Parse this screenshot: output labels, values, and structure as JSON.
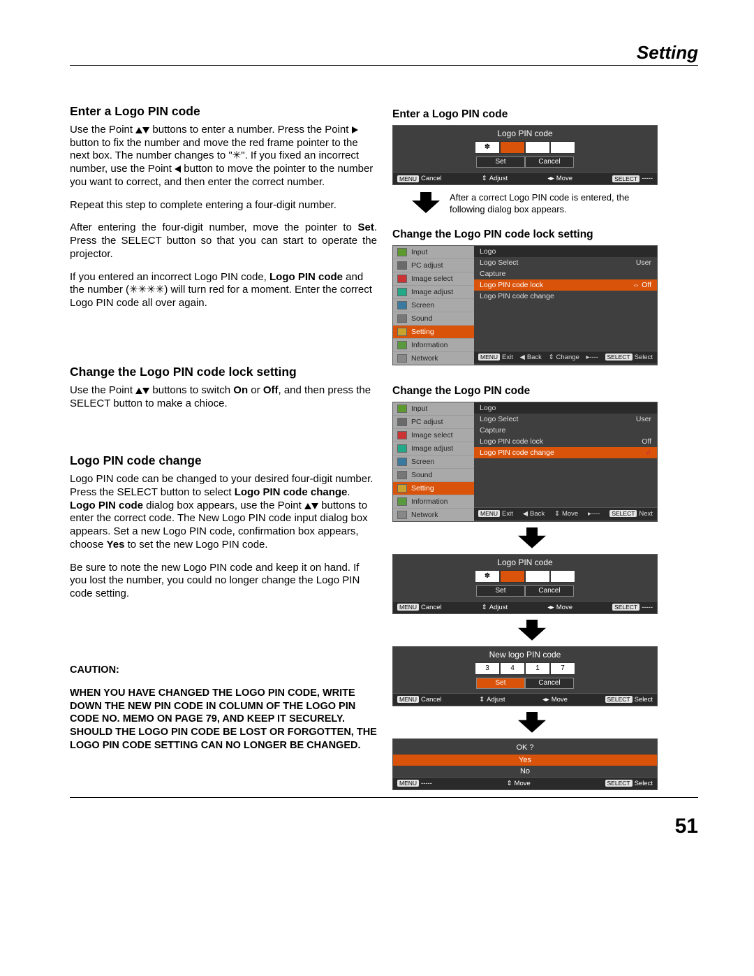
{
  "header": {
    "title": "Setting"
  },
  "left": {
    "h1": "Enter a Logo PIN code",
    "p1a": "Use the Point ",
    "p1b": "buttons to enter a number. Press the Point ",
    "p1c": " button to fix the number and move the red frame pointer to the next box. The number changes to \"✳\". If you fixed an incorrect number, use the Point ",
    "p1d": " button to move the pointer to the number you want to correct, and then enter the correct number.",
    "p2": "Repeat this step to complete entering a four-digit number.",
    "p3a": "After entering the four-digit number, move the pointer to ",
    "p3b": "Set",
    "p3c": ". Press the SELECT button so that you can start to operate the projector.",
    "p4a": "If you entered an incorrect Logo PIN code, ",
    "p4b": "Logo PIN code",
    "p4c": " and the number (✳✳✳✳) will turn red for a moment. Enter the correct Logo PIN code all over again.",
    "h2": "Change the Logo PIN code lock setting",
    "p5a": "Use the Point ",
    "p5b": " buttons to switch ",
    "p5c": "On",
    "p5d": " or ",
    "p5e": "Off",
    "p5f": ", and then press the SELECT button to make a chioce.",
    "h3": "Logo PIN code change",
    "p6a": "Logo PIN code can be changed to your desired four-digit number. Press the SELECT button to select ",
    "p6b": "Logo PIN code change",
    "p6c": ". ",
    "p6d": "Logo PIN code",
    "p6e": " dialog box appears, use the Point ",
    "p6f": " buttons to enter the correct code. The New Logo PIN code input dialog box appears. Set a new Logo PIN code, confirmation box appears, choose ",
    "p6g": "Yes",
    "p6h": " to set the new Logo PIN code.",
    "p7": "Be sure to note the new Logo PIN code and keep it on hand. If you lost the number, you could no longer change the Logo PIN code setting.",
    "caution_h": "CAUTION:",
    "caution": "WHEN YOU HAVE CHANGED THE LOGO PIN CODE, WRITE DOWN THE NEW PIN CODE IN COLUMN OF THE LOGO PIN CODE NO. MEMO ON PAGE 79, AND KEEP IT SECURELY. SHOULD THE LOGO PIN CODE BE LOST OR FORGOTTEN, THE LOGO PIN CODE SETTING CAN NO LONGER BE CHANGED."
  },
  "right": {
    "h1": "Enter a Logo PIN code",
    "pin1": {
      "title": "Logo PIN code",
      "digits": [
        "✽",
        "",
        "",
        ""
      ],
      "set": "Set",
      "cancel": "Cancel"
    },
    "foot_common": {
      "menu": "MENU",
      "cancel": "Cancel",
      "adjust": "Adjust",
      "move": "Move",
      "select": "SELECT",
      "dashes": "-----"
    },
    "note": "After a correct Logo PIN code is entered, the following dialog box appears.",
    "h2": "Change the Logo PIN code lock setting",
    "menu_side": [
      "Input",
      "PC adjust",
      "Image select",
      "Image adjust",
      "Screen",
      "Sound",
      "Setting",
      "Information",
      "Network"
    ],
    "menu_main1": {
      "head": "Logo",
      "rows": [
        {
          "l": "Logo Select",
          "r": "User",
          "sel": false
        },
        {
          "l": "Capture",
          "r": "",
          "sel": false
        },
        {
          "l": "Logo PIN code lock",
          "r": "⇔ Off",
          "sel": true
        },
        {
          "l": "Logo PIN code change",
          "r": "",
          "sel": false
        }
      ]
    },
    "menu_foot": {
      "exit": "Exit",
      "back": "Back",
      "change": "Change",
      "select": "Select",
      "move": "Move",
      "next": "Next"
    },
    "h3": "Change the Logo PIN code",
    "menu_main2": {
      "head": "Logo",
      "rows": [
        {
          "l": "Logo Select",
          "r": "User",
          "sel": false
        },
        {
          "l": "Capture",
          "r": "",
          "sel": false
        },
        {
          "l": "Logo PIN code lock",
          "r": "Off",
          "sel": false
        },
        {
          "l": "Logo PIN code change",
          "r": "",
          "sel": true
        }
      ]
    },
    "pin2": {
      "title": "Logo PIN code",
      "digits": [
        "✽",
        "",
        "",
        ""
      ],
      "set": "Set",
      "cancel": "Cancel"
    },
    "pin3": {
      "title": "New logo PIN code",
      "digits": [
        "3",
        "4",
        "1",
        "7"
      ],
      "set": "Set",
      "cancel": "Cancel",
      "setsel": true
    },
    "confirm": {
      "q": "OK ?",
      "yes": "Yes",
      "no": "No"
    }
  },
  "page_number": "51"
}
